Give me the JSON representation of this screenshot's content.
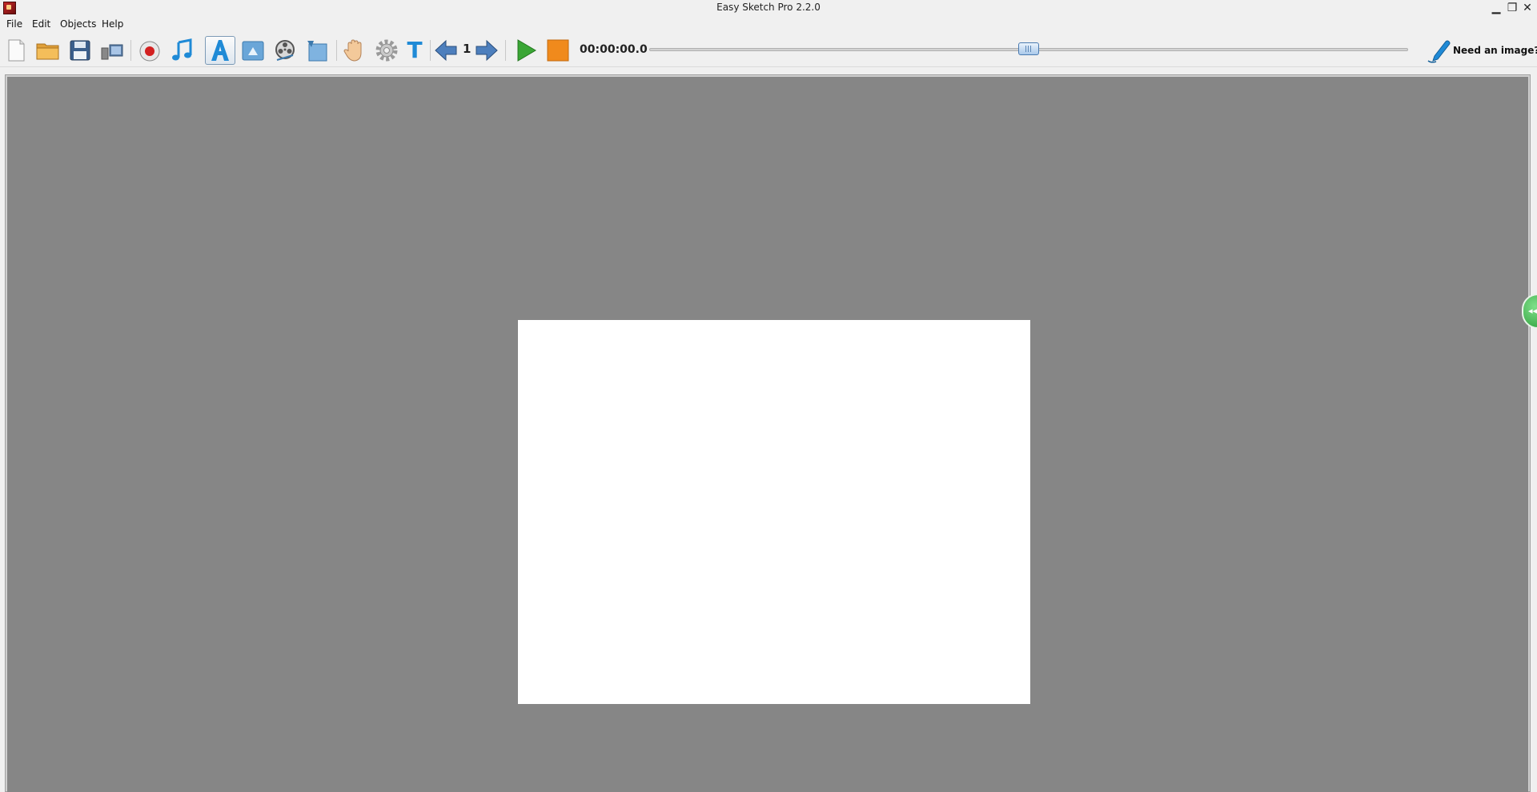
{
  "window": {
    "title": "Easy Sketch Pro 2.2.0",
    "minimize_glyph": "▁",
    "maximize_glyph": "❐",
    "close_glyph": "✕"
  },
  "menu": {
    "file": "File",
    "edit": "Edit",
    "objects": "Objects",
    "help": "Help"
  },
  "toolbar": {
    "icons": [
      "new-document-icon",
      "open-folder-icon",
      "save-disk-icon",
      "export-video-icon",
      "record-icon",
      "music-icon",
      "text-a-icon",
      "image-icon",
      "film-reel-icon",
      "background-icon",
      "hand-icon",
      "gear-icon",
      "text-t-icon",
      "arrow-left-icon",
      "arrow-right-icon",
      "play-icon",
      "stop-icon",
      "pen-icon"
    ],
    "text_tool_glyph": "T",
    "page_number": "1",
    "time": "00:00:00.0",
    "timeline_position": 0.5,
    "need_image_label": "Need an image?"
  },
  "side_panel": {
    "toggle_glyph": "◂◂"
  },
  "colors": {
    "canvas_bg": "#868686",
    "page_bg": "#ffffff",
    "accent_blue": "#1f8ad6",
    "play_green": "#3aa635",
    "stop_orange": "#f08a1c"
  }
}
